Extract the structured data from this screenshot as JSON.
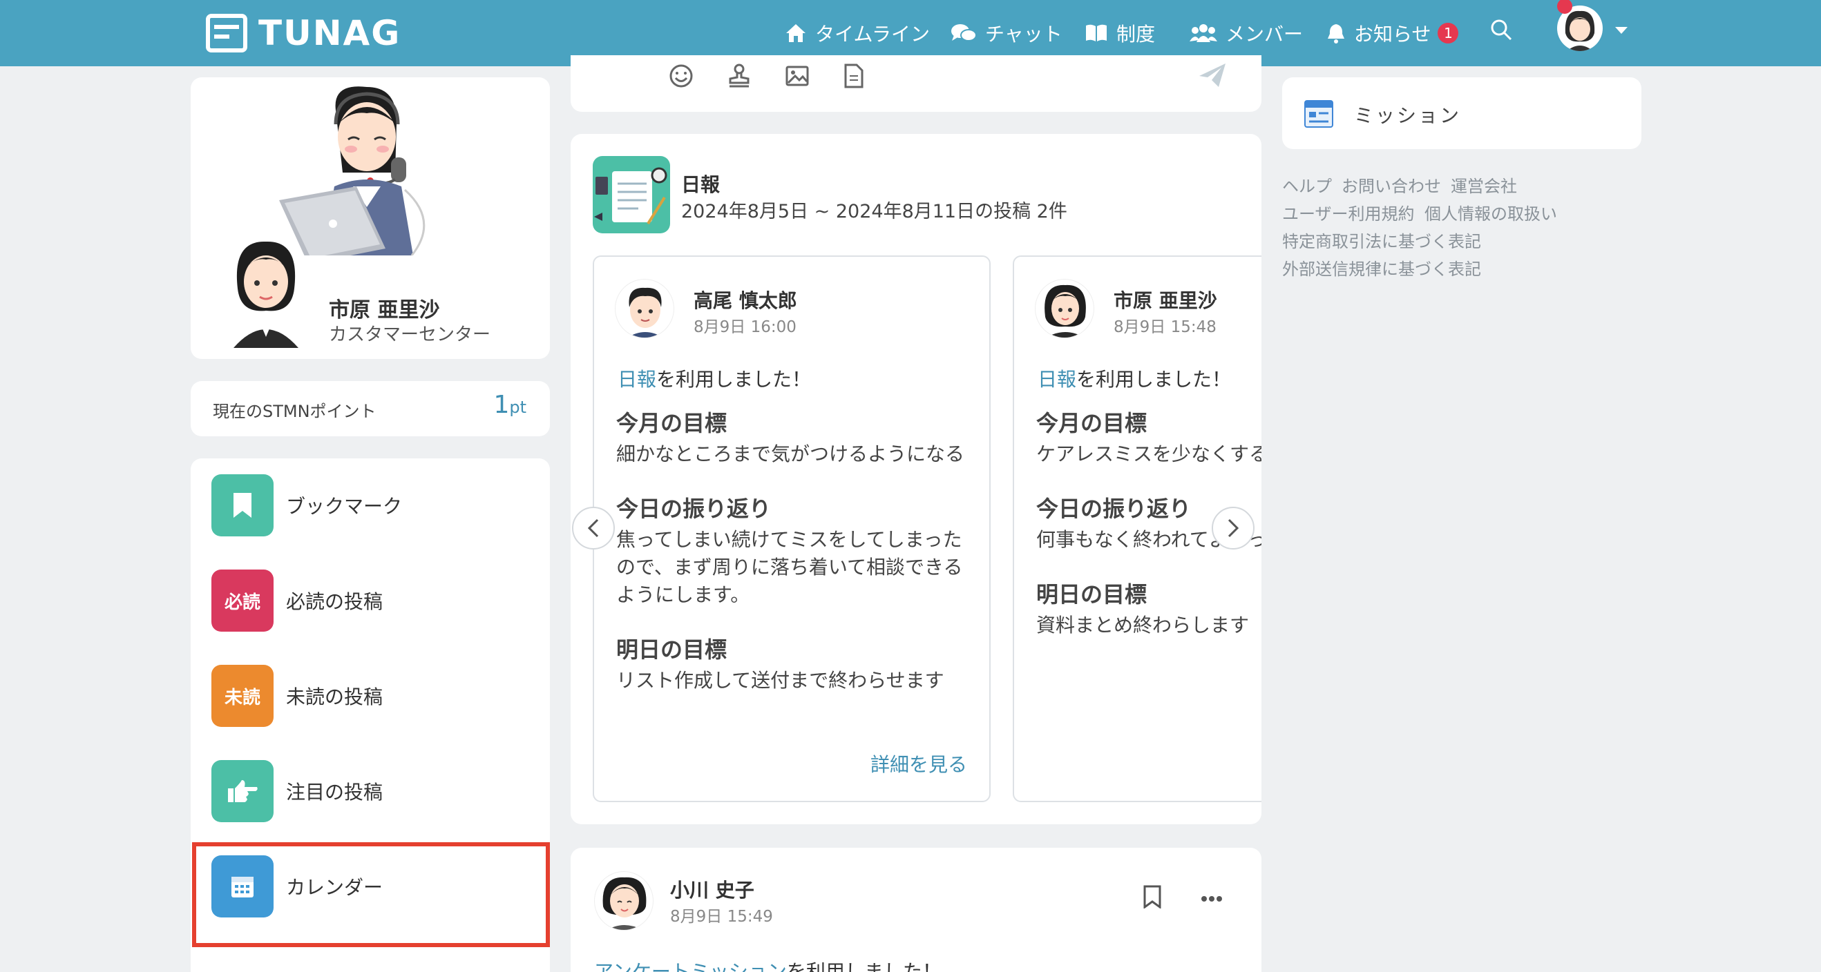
{
  "header": {
    "logo_text": "TUNAG",
    "nav": [
      {
        "label": "タイムライン",
        "icon": "home-icon"
      },
      {
        "label": "チャット",
        "icon": "chat-icon"
      },
      {
        "label": "制度",
        "icon": "book-icon"
      },
      {
        "label": "メンバー",
        "icon": "members-icon"
      },
      {
        "label": "お知らせ",
        "icon": "bell-icon",
        "badge": "1"
      }
    ]
  },
  "profile": {
    "name": "市原 亜里沙",
    "department": "カスタマーセンター"
  },
  "points": {
    "label": "現在のSTMNポイント",
    "value": "1",
    "unit": "pt"
  },
  "menu": [
    {
      "label": "ブックマーク",
      "icon_text": "",
      "color": "#4cbfa6"
    },
    {
      "label": "必読の投稿",
      "icon_text": "必読",
      "color": "#d9395e"
    },
    {
      "label": "未読の投稿",
      "icon_text": "未読",
      "color": "#ec8a2e"
    },
    {
      "label": "注目の投稿",
      "icon_text": "",
      "color": "#4cbfa6"
    },
    {
      "label": "カレンダー",
      "icon_text": "",
      "color": "#3f9ad6"
    }
  ],
  "report": {
    "title": "日報",
    "subtitle": "2024年8月5日 ~ 2024年8月11日の投稿 2件",
    "cards": [
      {
        "author": "高尾 慎太郎",
        "time": "8月9日 16:00",
        "used_link": "日報",
        "used_text": "を利用しました！",
        "sections": [
          {
            "heading": "今月の目標",
            "lines": [
              "細かなところまで気がつけるようになる"
            ]
          },
          {
            "heading": "今日の振り返り",
            "lines": [
              "焦ってしまい続けてミスをしてしまった",
              "ので、まず周りに落ち着いて相談できる",
              "ようにします。"
            ]
          },
          {
            "heading": "明日の目標",
            "lines": [
              "リスト作成して送付まで終わらせます"
            ]
          }
        ],
        "more": "詳細を見る"
      },
      {
        "author": "市原 亜里沙",
        "time": "8月9日 15:48",
        "used_link": "日報",
        "used_text": "を利用しました！",
        "sections": [
          {
            "heading": "今月の目標",
            "lines": [
              "ケアレスミスを少なくする"
            ]
          },
          {
            "heading": "今日の振り返り",
            "lines": [
              "何事もなく終われてよかった"
            ]
          },
          {
            "heading": "明日の目標",
            "lines": [
              "資料まとめ終わらします"
            ]
          }
        ]
      }
    ]
  },
  "post": {
    "author": "小川 史子",
    "time": "8月9日 15:49",
    "link_text": "アンケートミッション",
    "text": "を利用しました！"
  },
  "right": {
    "mission": "ミッション",
    "footer_links": [
      [
        "ヘルプ",
        "お問い合わせ",
        "運営会社"
      ],
      [
        "ユーザー利用規約",
        "個人情報の取扱い"
      ],
      [
        "特定商取引法に基づく表記"
      ],
      [
        "外部送信規律に基づく表記"
      ]
    ]
  },
  "colors": {
    "header": "#4aa3c1",
    "link": "#3f8fb3",
    "highlight": "#e5402f"
  }
}
